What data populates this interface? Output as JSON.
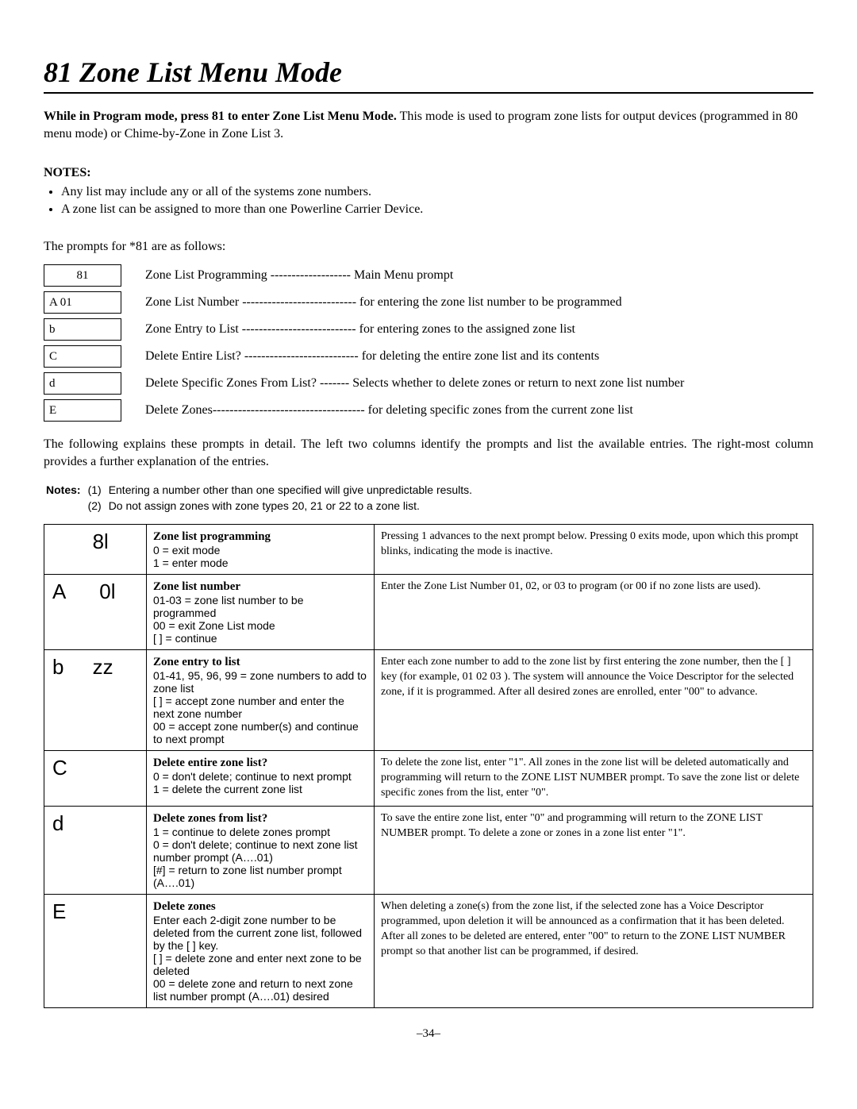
{
  "title": "81 Zone List Menu Mode",
  "intro": {
    "bold": "While in Program mode, press  81 to enter Zone List Menu Mode.",
    "rest": " This mode is used to program zone lists for output devices (programmed in   80 menu mode) or Chime-by-Zone in Zone List 3."
  },
  "notes_heading": "NOTES:",
  "notes": [
    "Any list may include any or all of the systems zone numbers.",
    "A zone list can be assigned to more than one Powerline Carrier Device."
  ],
  "prompts_lead": "The prompts for *81 are as follows:",
  "summary": [
    {
      "code": "81",
      "align": "center",
      "label": "Zone List Programming ------------------- Main Menu prompt"
    },
    {
      "code": "A  01",
      "align": "left",
      "label": "Zone List Number --------------------------- for entering the zone list number to be programmed"
    },
    {
      "code": "b",
      "align": "left",
      "label": "Zone Entry to List --------------------------- for entering zones to the assigned zone list"
    },
    {
      "code": "C",
      "align": "left",
      "label": "Delete Entire List? --------------------------- for deleting the entire zone list and its contents"
    },
    {
      "code": "d",
      "align": "left",
      "label": "Delete Specific Zones From List? ------- Selects whether to delete zones or return to next zone list number"
    },
    {
      "code": "E",
      "align": "left",
      "label": "Delete Zones------------------------------------ for deleting specific zones from the current zone list"
    }
  ],
  "explain": "The following explains these prompts in detail. The left two columns identify the prompts and list the available entries. The right-most column provides a further explanation of the entries.",
  "subnotes_label": "Notes:",
  "subnotes": [
    {
      "n": "(1)",
      "text": "Entering a number other than one specified will give unpredictable results."
    },
    {
      "n": "(2)",
      "text": "Do not assign zones with zone types 20, 21 or 22 to a zone list."
    }
  ],
  "detail": [
    {
      "display": "       8l",
      "middle_hdr": "Zone list programming",
      "middle_lines": [
        "0 = exit mode",
        "1 = enter mode"
      ],
      "right": "Pressing 1 advances to the next prompt below.\nPressing 0 exits mode, upon which this prompt blinks, indicating the mode is inactive."
    },
    {
      "display": "A      0l",
      "middle_hdr": "Zone list number",
      "middle_lines": [
        "01-03 = zone list number to be programmed",
        "00 = exit Zone List mode",
        "[  ] = continue"
      ],
      "right": "Enter the Zone List Number 01, 02, or 03 to program (or 00 if no zone lists are used)."
    },
    {
      "display": "b     zz",
      "middle_hdr": "Zone entry to list",
      "middle_lines": [
        "01-41, 95, 96, 99 = zone numbers to add to zone list",
        "[  ] = accept zone number and enter the next zone number",
        "00 = accept zone number(s) and continue to next prompt"
      ],
      "right": "Enter each zone number to add to the zone list by first entering the zone number, then the [  ] key (for example, 01  02  03  ). The system will announce the Voice Descriptor for the selected zone, if it is programmed. After all desired zones are enrolled, enter \"00\" to advance."
    },
    {
      "display": "C",
      "middle_hdr": "Delete entire zone list?",
      "middle_lines": [
        "0 = don't delete; continue to next prompt",
        "1 = delete the current zone list"
      ],
      "right": "To delete the zone list, enter \"1\". All zones in the zone list will be deleted automatically and programming will return to the ZONE LIST NUMBER prompt.\nTo save the zone list or delete specific zones from the list, enter \"0\"."
    },
    {
      "display": "d",
      "middle_hdr": "Delete zones from list?",
      "middle_lines": [
        "1 = continue to delete zones prompt",
        "0 = don't delete; continue to next zone list number prompt (A….01)",
        "[#] = return to zone list number prompt (A….01)"
      ],
      "right": "To save the entire zone list, enter \"0\" and programming will return to the ZONE LIST NUMBER prompt.\nTo delete a zone or zones in a zone list enter \"1\"."
    },
    {
      "display": "E",
      "middle_hdr": "Delete zones",
      "middle_lines": [
        "Enter each 2-digit zone number to be deleted from the current zone list, followed by the [  ] key.",
        "[  ] = delete zone and enter next zone to be deleted",
        "00 = delete zone and return to next zone list number prompt (A….01) desired"
      ],
      "right": "When deleting a zone(s) from the zone list, if the selected zone has a Voice Descriptor programmed, upon deletion it will be announced as a confirmation that it has been deleted. After all zones to be deleted are entered, enter \"00\" to return to the ZONE LIST NUMBER prompt so that another list can be programmed, if desired."
    }
  ],
  "pagenum": "–34–"
}
